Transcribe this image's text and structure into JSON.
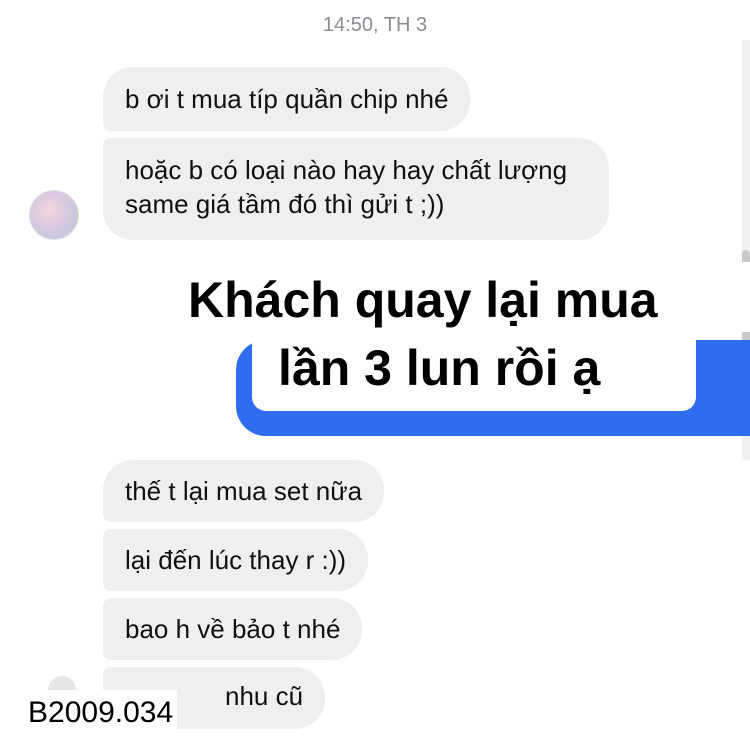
{
  "chat": {
    "timestamp": "14:50, TH 3",
    "messages_top": [
      "b ơi t mua típ quần chip nhé",
      "hoặc b có loại nào hay hay chất lượng same giá tầm đó thì gửi t ;))"
    ],
    "messages_bottom": [
      "thế t lại mua set nữa",
      "lại đến lúc thay r :))",
      "bao h về bảo t nhé",
      "nhu cũ"
    ],
    "sent_bubble_color": "#2f6df0",
    "received_bubble_color": "#efeff0"
  },
  "overlay": {
    "line1": "Khách quay lại mua",
    "line2": "lần 3 lun rồi ạ"
  },
  "watermark": {
    "code": "B2009.034"
  }
}
